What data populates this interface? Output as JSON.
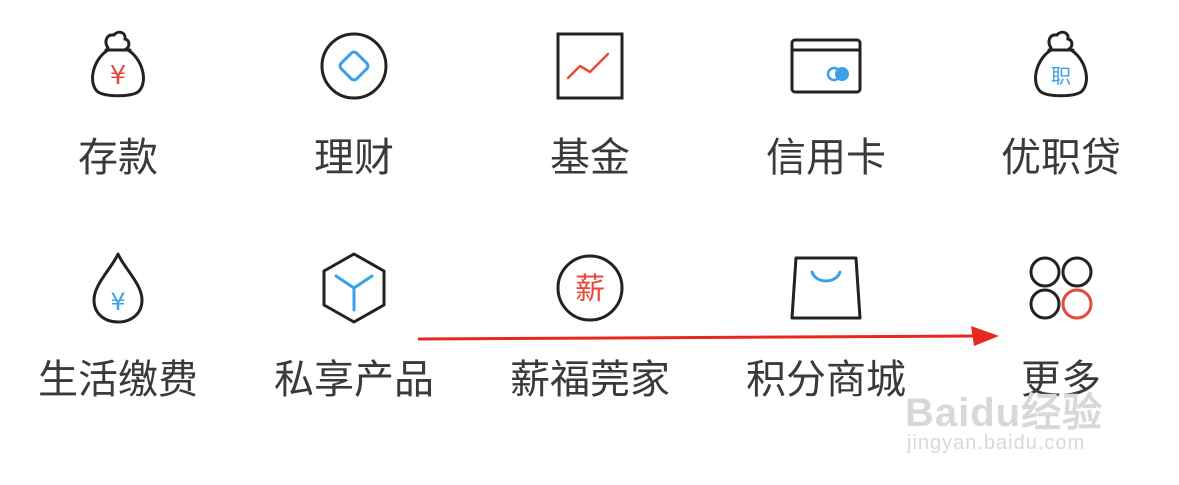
{
  "menu": {
    "items": [
      {
        "label": "存款",
        "icon": "money-bag-yuan-icon"
      },
      {
        "label": "理财",
        "icon": "diamond-circle-icon"
      },
      {
        "label": "基金",
        "icon": "line-chart-icon"
      },
      {
        "label": "信用卡",
        "icon": "credit-card-icon"
      },
      {
        "label": "优职贷",
        "icon": "money-bag-job-icon"
      },
      {
        "label": "生活缴费",
        "icon": "water-drop-yuan-icon"
      },
      {
        "label": "私享产品",
        "icon": "cube-icon"
      },
      {
        "label": "薪福莞家",
        "icon": "salary-badge-icon"
      },
      {
        "label": "积分商城",
        "icon": "shopping-bag-icon"
      },
      {
        "label": "更多",
        "icon": "four-circles-icon"
      }
    ],
    "icon_glyphs": {
      "yuan": "¥",
      "job": "职",
      "salary": "薪"
    }
  },
  "colors": {
    "icon_stroke": "#222222",
    "accent_red": "#e8483b",
    "accent_blue": "#3aa0e8",
    "label_text": "#3a3a3a",
    "annotation_arrow": "#e8271f"
  },
  "watermark": {
    "brand": "Baidu经验",
    "url": "jingyan.baidu.com"
  }
}
